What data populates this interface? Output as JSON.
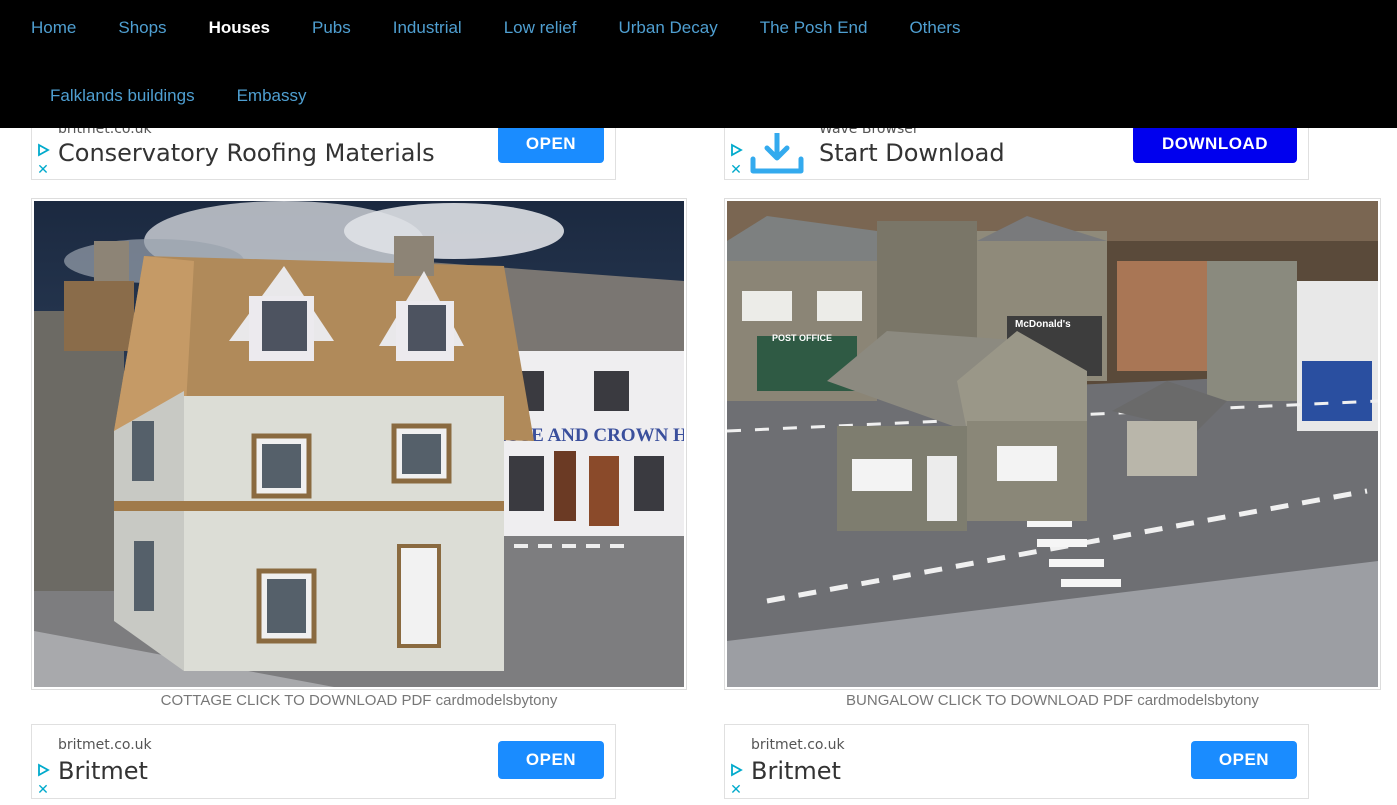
{
  "nav": {
    "row1": [
      "Home",
      "Shops",
      "Houses",
      "Pubs",
      "Industrial",
      "Low relief",
      "Urban Decay",
      "The Posh End",
      "Others"
    ],
    "row2": [
      "Falklands buildings",
      "Embassy"
    ],
    "active": "Houses"
  },
  "ads": {
    "top_left": {
      "domain": "britmet.co.uk",
      "headline": "Conservatory Roofing Materials",
      "cta": "OPEN",
      "cta_color": "#1a8cff"
    },
    "top_right": {
      "domain": "Wave Browser",
      "headline": "Start Download",
      "cta": "DOWNLOAD",
      "cta_color": "#0000ee",
      "icon": "download-icon"
    },
    "bottom_left": {
      "domain": "britmet.co.uk",
      "headline": "Britmet",
      "cta": "OPEN",
      "cta_color": "#1a8cff"
    },
    "bottom_right": {
      "domain": "britmet.co.uk",
      "headline": "Britmet",
      "cta": "OPEN",
      "cta_color": "#1a8cff"
    },
    "close_glyph": "✕"
  },
  "gallery": [
    {
      "caption": "COTTAGE CLICK TO DOWNLOAD PDF cardmodelsbytony",
      "sign": "ROSE AND CROWN HO"
    },
    {
      "caption": "BUNGALOW CLICK TO DOWNLOAD PDF cardmodelsbytony",
      "sign_a": "POST OFFICE",
      "sign_b": "McDonald's"
    }
  ]
}
